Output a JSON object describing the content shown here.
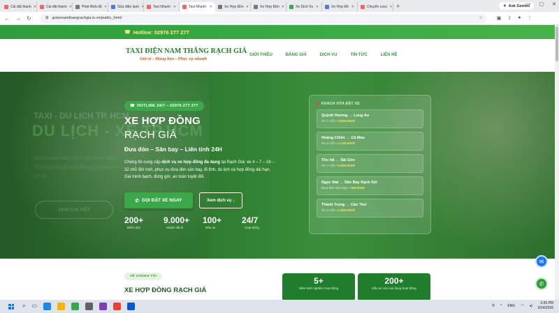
{
  "browser": {
    "tabs": [
      {
        "title": "Cài đặt thanh",
        "fav": "red"
      },
      {
        "title": "Cài đặt thanh",
        "fav": "red"
      },
      {
        "title": "Phát Web độ",
        "fav": "gray"
      },
      {
        "title": "Sửa điện lạnh",
        "fav": "blue"
      },
      {
        "title": "Taxi Nhanh",
        "fav": "red"
      },
      {
        "title": "Taxi Nhanh",
        "fav": "red",
        "active": true
      },
      {
        "title": "Xe Hợp Đồn",
        "fav": "gray"
      },
      {
        "title": "Xe Hợp Đồn",
        "fav": "gray"
      },
      {
        "title": "Xe Dịch Vụ",
        "fav": "green"
      },
      {
        "title": "Xe Hợp Đồ",
        "fav": "blue"
      },
      {
        "title": "Chuyển coco",
        "fav": "red"
      }
    ],
    "gemini_label": "Ask Gemini",
    "url": "goixenamthangrachgia.io.vn/public_html/"
  },
  "topbar": {
    "hotline_label": "Hotline: 02976 277 277"
  },
  "header": {
    "logo_name": "TAXI ĐIỆN NAM THẮNG RẠCH GIÁ",
    "logo_slogan": "Giá rẻ - Đúng hẹn - Phục vụ nhanh",
    "menu": [
      "GIỚI THIỆU",
      "BẢNG GIÁ",
      "DỊCH VỤ",
      "TIN TỨC",
      "LIÊN HỆ"
    ]
  },
  "hero": {
    "ghost_small": "TAXI - DU LỊCH TP. HCM",
    "ghost_big": "DU LỊCH - XE TP.HCM",
    "ghost_para": "Dịch vụ taxi nặng Đảo Việt Chức năng – Thương hiệu tồ hoạt động 24/7 Mọi nơi – Có xe",
    "ghost_button": "XEM CHI TIẾT",
    "badge": "HOTLINE 24/7 – 02976 277 277",
    "title": "XE HỢP ĐỒNG",
    "subtitle": "RẠCH GIÁ",
    "tagline": "Đưa đón – Sân bay – Liên tỉnh 24H",
    "desc_prefix": "Chúng tôi cung cấp ",
    "desc_bold": "dịch vụ xe hợp đồng đa dạng",
    "desc_suffix": " tại Rạch Giá: xe 4 – 7 – 16 – 32 chỗ đời mới, phục vụ đưa đón sân bay, đi tỉnh, du lịch và hợp đồng dài hạn. Giá minh bạch, đúng giờ, an toàn tuyệt đối.",
    "book_button": "GỌI ĐẶT XE NGAY",
    "services_button": "Xem dịch vụ ↓",
    "stats": [
      {
        "num": "200+",
        "label": "Điểm đón"
      },
      {
        "num": "9.000+",
        "label": "Khách đã đi"
      },
      {
        "num": "100+",
        "label": "Đầu xe"
      },
      {
        "num": "24/7",
        "label": "Hoạt động"
      }
    ]
  },
  "recent": {
    "title": "KHÁCH VỪA ĐẶT XE",
    "bookings": [
      {
        "route": "Quỳnh Hương → Long An",
        "meta": "Xe 7 chỗ • ",
        "price": "2.800.000đ"
      },
      {
        "route": "Hoàng Chiến → Cà Mau",
        "meta": "Xe 4 chỗ • ",
        "price": "2.100.000đ"
      },
      {
        "route": "Thu Hà → Sài Gòn",
        "meta": "Xe 7 chỗ • ",
        "price": "2.500.000đ"
      },
      {
        "route": "Ngọc Mai → Sân Bay Rạch Sỏi",
        "meta": "Đưa đón sân bay • ",
        "price": "180.000đ"
      },
      {
        "route": "Thành Trung → Cần Thơ",
        "meta": "Xe 4 chỗ • ",
        "price": "1.300.000đ"
      }
    ]
  },
  "why": {
    "badge": "VỀ CHÚNG TÔI",
    "title": "XE HỢP ĐỒNG RẠCH GIÁ",
    "cards": [
      {
        "num": "5+",
        "label": "Năm kinh nghiệm hoạt động"
      },
      {
        "num": "200+",
        "label": "Đầu xe các loại đang hoạt động"
      }
    ]
  },
  "taskbar": {
    "lang": "ENG",
    "time": "3:35 PM",
    "date": "6/24/2026"
  }
}
